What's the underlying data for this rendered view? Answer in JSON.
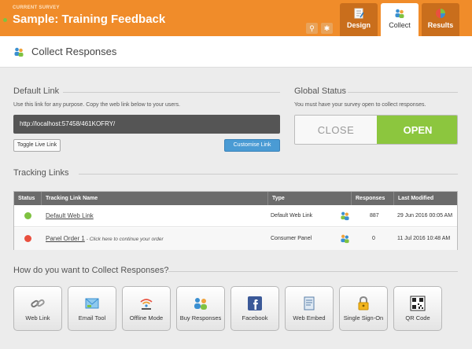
{
  "header": {
    "current_survey_label": "CURRENT SURVEY",
    "survey_title": "Sample: Training Feedback",
    "tabs": [
      {
        "label": "Design",
        "icon": "design-icon"
      },
      {
        "label": "Collect",
        "icon": "users-icon"
      },
      {
        "label": "Results",
        "icon": "pie-chart-icon"
      }
    ],
    "active_tab": "Collect"
  },
  "page": {
    "title": "Collect Responses"
  },
  "default_link": {
    "heading": "Default Link",
    "help": "Use this link for any purpose. Copy the web link below to your users.",
    "url": "http://localhost:57458/461KOFRY/",
    "toggle_label": "Toggle Live Link",
    "customise_label": "Customise Link"
  },
  "global_status": {
    "heading": "Global Status",
    "help": "You must have your survey open to collect responses.",
    "close_label": "CLOSE",
    "open_label": "OPEN",
    "state": "open"
  },
  "tracking": {
    "heading": "Tracking Links",
    "columns": [
      "Status",
      "Tracking Link Name",
      "Type",
      "Responses",
      "Last Modified"
    ],
    "rows": [
      {
        "status_color": "#7fc241",
        "name": "Default Web Link",
        "hint": "",
        "type": "Default Web Link",
        "type_icon": "link-users-icon",
        "responses": "887",
        "modified": "29 Jun 2016 00:05 AM"
      },
      {
        "status_color": "#e9503f",
        "name": "Panel Order 1",
        "hint": "- Click here to continue your order",
        "type": "Consumer Panel",
        "type_icon": "panel-users-icon",
        "responses": "0",
        "modified": "11 Jul 2016 10:48 AM"
      }
    ]
  },
  "methods": {
    "heading": "How do you want to Collect Responses?",
    "items": [
      {
        "label": "Web Link",
        "icon": "chain-link-icon"
      },
      {
        "label": "Email Tool",
        "icon": "envelope-icon"
      },
      {
        "label": "Offline Mode",
        "icon": "wifi-icon"
      },
      {
        "label": "Buy Responses",
        "icon": "users-icon"
      },
      {
        "label": "Facebook",
        "icon": "facebook-icon"
      },
      {
        "label": "Web Embed",
        "icon": "embed-scroll-icon"
      },
      {
        "label": "Single Sign-On",
        "icon": "padlock-icon"
      },
      {
        "label": "QR Code",
        "icon": "qr-code-icon"
      }
    ]
  }
}
